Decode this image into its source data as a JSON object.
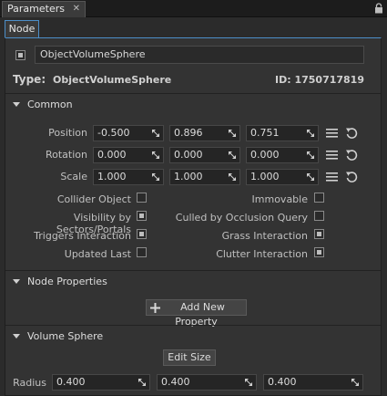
{
  "window": {
    "tab_title": "Parameters",
    "close_glyph": "✕"
  },
  "subtab": {
    "label": "Node"
  },
  "node": {
    "enabled": true,
    "name": "ObjectVolumeSphere",
    "type_label": "Type:",
    "type_value": "ObjectVolumeSphere",
    "id_label": "ID:",
    "id_value": "1750717819"
  },
  "common": {
    "title": "Common",
    "rows": [
      {
        "label": "Position",
        "values": [
          "-0.500",
          "0.896",
          "0.751"
        ]
      },
      {
        "label": "Rotation",
        "values": [
          "0.000",
          "0.000",
          "0.000"
        ]
      },
      {
        "label": "Scale",
        "values": [
          "1.000",
          "1.000",
          "1.000"
        ]
      }
    ],
    "flags_left": [
      {
        "label": "Collider Object",
        "checked": false
      },
      {
        "label": "Visibility by Sectors/Portals",
        "checked": true
      },
      {
        "label": "Triggers Interaction",
        "checked": true
      },
      {
        "label": "Updated Last",
        "checked": false
      }
    ],
    "flags_right": [
      {
        "label": "Immovable",
        "checked": false
      },
      {
        "label": "Culled by Occlusion Query",
        "checked": false
      },
      {
        "label": "Grass Interaction",
        "checked": true
      },
      {
        "label": "Clutter Interaction",
        "checked": true
      }
    ]
  },
  "node_properties": {
    "title": "Node Properties",
    "add_label": "Add New Property"
  },
  "volume_sphere": {
    "title": "Volume Sphere",
    "edit_label": "Edit Size",
    "radius_label": "Radius",
    "radius_values": [
      "0.400",
      "0.400",
      "0.400"
    ]
  },
  "colors": {
    "accent": "#4c8ec8",
    "panel": "#333333",
    "field": "#252525"
  }
}
